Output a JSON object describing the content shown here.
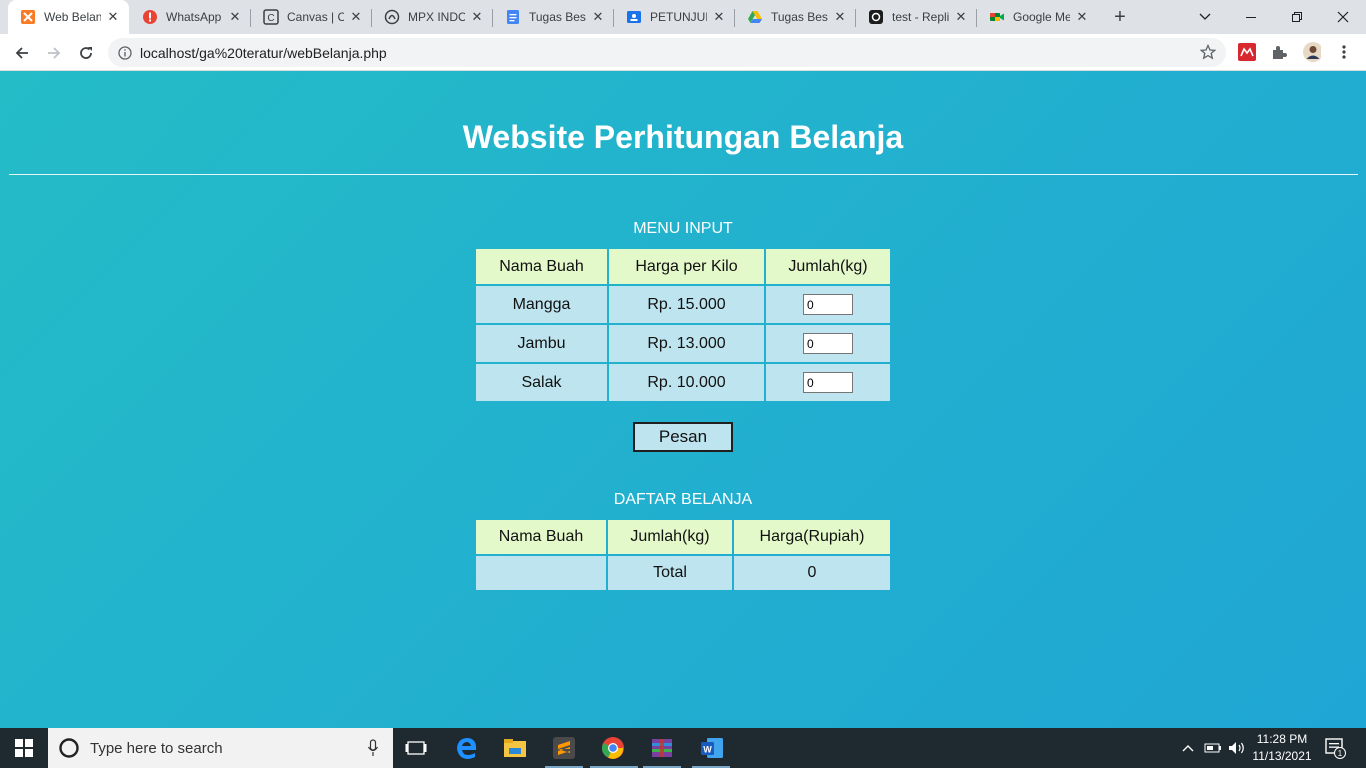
{
  "browser": {
    "tabs": [
      {
        "title": "Web Belanja",
        "active": true,
        "favicon": "xampp-icon"
      },
      {
        "title": "WhatsApp",
        "active": false,
        "favicon": "whatsapp-alert-icon"
      },
      {
        "title": "Canvas | Course",
        "active": false,
        "favicon": "canvas-icon"
      },
      {
        "title": "MPX INDONESIA",
        "active": false,
        "favicon": "mpx-icon"
      },
      {
        "title": "Tugas Besar",
        "active": false,
        "favicon": "google-docs-icon"
      },
      {
        "title": "PETUNJUK",
        "active": false,
        "favicon": "google-classroom-icon"
      },
      {
        "title": "Tugas Besar",
        "active": false,
        "favicon": "google-drive-icon"
      },
      {
        "title": "test - Replit",
        "active": false,
        "favicon": "replit-icon"
      },
      {
        "title": "Google Meet",
        "active": false,
        "favicon": "google-meet-icon"
      }
    ],
    "url": "localhost/ga%20teratur/webBelanja.php"
  },
  "page": {
    "title": "Website Perhitungan Belanja",
    "menu_input": {
      "heading": "MENU INPUT",
      "headers": [
        "Nama Buah",
        "Harga per Kilo",
        "Jumlah(kg)"
      ],
      "rows": [
        {
          "name": "Mangga",
          "price": "Rp. 15.000",
          "qty": "0"
        },
        {
          "name": "Jambu",
          "price": "Rp. 13.000",
          "qty": "0"
        },
        {
          "name": "Salak",
          "price": "Rp. 10.000",
          "qty": "0"
        }
      ],
      "submit_label": "Pesan"
    },
    "daftar_belanja": {
      "heading": "DAFTAR BELANJA",
      "headers": [
        "Nama Buah",
        "Jumlah(kg)",
        "Harga(Rupiah)"
      ],
      "total_label": "Total",
      "total_value": "0"
    }
  },
  "taskbar": {
    "search_placeholder": "Type here to search",
    "time": "11:28 PM",
    "date": "11/13/2021",
    "notification_count": "1"
  },
  "colors": {
    "page_bg": "#22b3cf",
    "header_cell": "#e3f9c9",
    "body_cell": "#bde4ef"
  }
}
